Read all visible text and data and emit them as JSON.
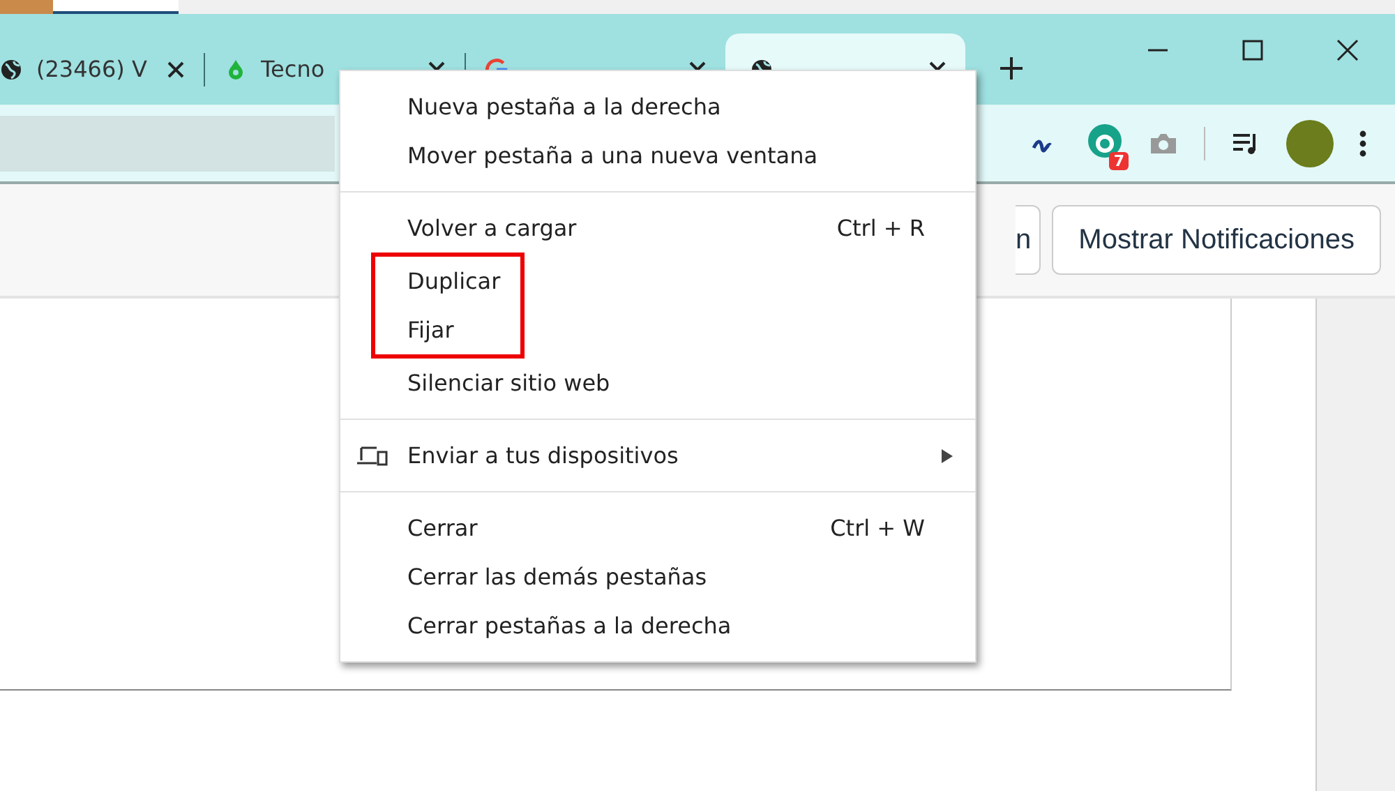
{
  "tabs": [
    {
      "title": "(23466) V",
      "selected": false
    },
    {
      "title": "Tecno",
      "selected": false
    },
    {
      "selected": false
    },
    {
      "selected": true
    }
  ],
  "toolbar": {
    "extension_badge": "7"
  },
  "page": {
    "buttons": [
      "n",
      "Mostrar Notificaciones"
    ]
  },
  "context_menu": {
    "sections": [
      [
        {
          "label": "Nueva pestaña a la derecha"
        },
        {
          "label": "Mover pestaña a una nueva ventana"
        }
      ],
      [
        {
          "label": "Volver a cargar",
          "shortcut": "Ctrl + R",
          "highlighted": false
        },
        {
          "label": "Duplicar",
          "highlighted": true
        },
        {
          "label": "Fijar",
          "highlighted": true
        },
        {
          "label": "Silenciar sitio web",
          "highlighted": false
        }
      ],
      [
        {
          "label": "Enviar a tus dispositivos",
          "kind": "submenu"
        }
      ],
      [
        {
          "label": "Cerrar",
          "shortcut": "Ctrl + W"
        },
        {
          "label": "Cerrar las demás pestañas"
        },
        {
          "label": "Cerrar pestañas a la derecha"
        }
      ]
    ]
  }
}
